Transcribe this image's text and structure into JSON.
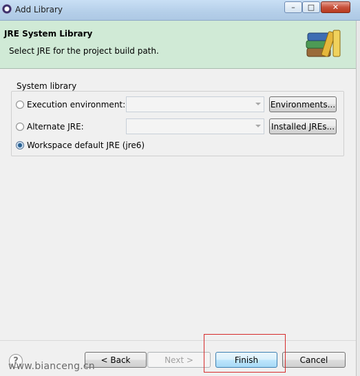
{
  "window": {
    "title": "Add Library"
  },
  "header": {
    "title": "JRE System Library",
    "description": "Select JRE for the project build path."
  },
  "group": {
    "title": "System library",
    "options": [
      {
        "label": "Execution environment:",
        "selected": false,
        "combo_value": "",
        "button": "Environments..."
      },
      {
        "label": "Alternate JRE:",
        "selected": false,
        "combo_value": "",
        "button": "Installed JREs..."
      },
      {
        "label": "Workspace default JRE (jre6)",
        "selected": true
      }
    ]
  },
  "footer": {
    "back": "< Back",
    "next": "Next >",
    "finish": "Finish",
    "cancel": "Cancel"
  },
  "watermark": "www.bianceng.cn",
  "colors": {
    "header_bg": "#d0ead6",
    "highlight": "#d62b2b"
  }
}
